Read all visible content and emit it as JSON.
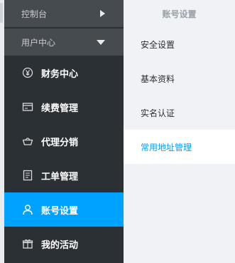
{
  "sidebar": {
    "groups": [
      {
        "label": "控制台",
        "icon": "triangle-right"
      },
      {
        "label": "用户中心",
        "icon": "triangle-down"
      }
    ],
    "items": [
      {
        "label": "财务中心",
        "icon": "yen-circle-icon",
        "active": false
      },
      {
        "label": "续费管理",
        "icon": "card-icon",
        "active": false
      },
      {
        "label": "代理分销",
        "icon": "basket-icon",
        "active": false
      },
      {
        "label": "工单管理",
        "icon": "document-icon",
        "active": false
      },
      {
        "label": "账号设置",
        "icon": "user-icon",
        "active": true
      },
      {
        "label": "我的活动",
        "icon": "gift-icon",
        "active": false
      }
    ]
  },
  "panel": {
    "title": "账号设置",
    "items": [
      {
        "label": "安全设置",
        "active": false
      },
      {
        "label": "基本资料",
        "active": false
      },
      {
        "label": "实名认证",
        "active": false
      },
      {
        "label": "常用地址管理",
        "active": true
      }
    ]
  },
  "colors": {
    "sidebar_bg": "#2b3035",
    "group_bg": "#464b50",
    "accent": "#00a2ff",
    "panel_bg": "#f0f2f5"
  }
}
